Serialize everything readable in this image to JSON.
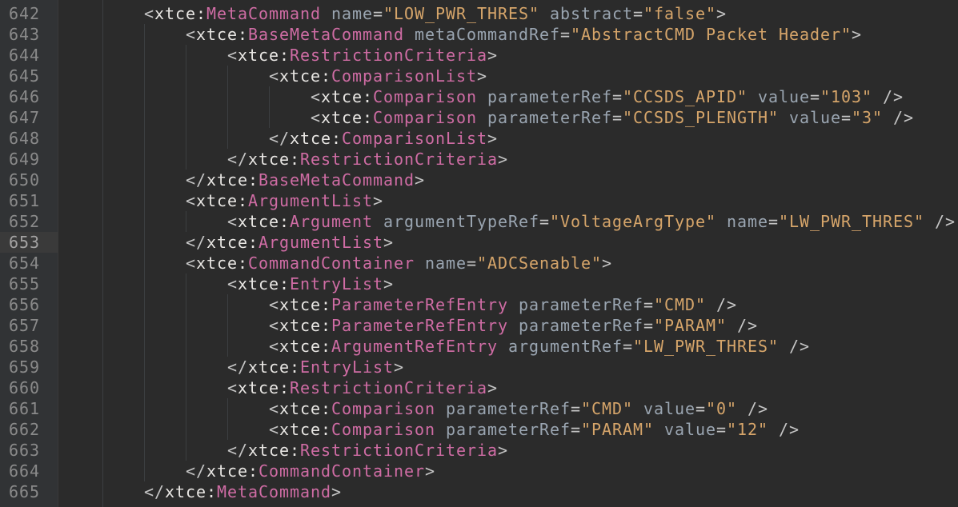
{
  "editor": {
    "current_line": "653",
    "lines": [
      {
        "num": "642",
        "indent": 4,
        "parts": [
          {
            "t": "punct",
            "v": "<"
          },
          {
            "t": "ns",
            "v": "xtce:"
          },
          {
            "t": "tag",
            "v": "MetaCommand"
          },
          {
            "t": "sp",
            "v": " "
          },
          {
            "t": "attr",
            "v": "name"
          },
          {
            "t": "eq",
            "v": "="
          },
          {
            "t": "val",
            "v": "\"LOW_PWR_THRES\""
          },
          {
            "t": "sp",
            "v": " "
          },
          {
            "t": "attr",
            "v": "abstract"
          },
          {
            "t": "eq",
            "v": "="
          },
          {
            "t": "val",
            "v": "\"false\""
          },
          {
            "t": "punct",
            "v": ">"
          }
        ]
      },
      {
        "num": "643",
        "indent": 8,
        "parts": [
          {
            "t": "punct",
            "v": "<"
          },
          {
            "t": "ns",
            "v": "xtce:"
          },
          {
            "t": "tag",
            "v": "BaseMetaCommand"
          },
          {
            "t": "sp",
            "v": " "
          },
          {
            "t": "attr",
            "v": "metaCommandRef"
          },
          {
            "t": "eq",
            "v": "="
          },
          {
            "t": "val",
            "v": "\"AbstractCMD Packet Header\""
          },
          {
            "t": "punct",
            "v": ">"
          }
        ]
      },
      {
        "num": "644",
        "indent": 12,
        "parts": [
          {
            "t": "punct",
            "v": "<"
          },
          {
            "t": "ns",
            "v": "xtce:"
          },
          {
            "t": "tag",
            "v": "RestrictionCriteria"
          },
          {
            "t": "punct",
            "v": ">"
          }
        ]
      },
      {
        "num": "645",
        "indent": 16,
        "parts": [
          {
            "t": "punct",
            "v": "<"
          },
          {
            "t": "ns",
            "v": "xtce:"
          },
          {
            "t": "tag",
            "v": "ComparisonList"
          },
          {
            "t": "punct",
            "v": ">"
          }
        ]
      },
      {
        "num": "646",
        "indent": 20,
        "parts": [
          {
            "t": "punct",
            "v": "<"
          },
          {
            "t": "ns",
            "v": "xtce:"
          },
          {
            "t": "tag",
            "v": "Comparison"
          },
          {
            "t": "sp",
            "v": " "
          },
          {
            "t": "attr",
            "v": "parameterRef"
          },
          {
            "t": "eq",
            "v": "="
          },
          {
            "t": "val",
            "v": "\"CCSDS_APID\""
          },
          {
            "t": "sp",
            "v": " "
          },
          {
            "t": "attr",
            "v": "value"
          },
          {
            "t": "eq",
            "v": "="
          },
          {
            "t": "val",
            "v": "\"103\""
          },
          {
            "t": "sp",
            "v": " "
          },
          {
            "t": "punct",
            "v": "/>"
          }
        ]
      },
      {
        "num": "647",
        "indent": 20,
        "parts": [
          {
            "t": "punct",
            "v": "<"
          },
          {
            "t": "ns",
            "v": "xtce:"
          },
          {
            "t": "tag",
            "v": "Comparison"
          },
          {
            "t": "sp",
            "v": " "
          },
          {
            "t": "attr",
            "v": "parameterRef"
          },
          {
            "t": "eq",
            "v": "="
          },
          {
            "t": "val",
            "v": "\"CCSDS_PLENGTH\""
          },
          {
            "t": "sp",
            "v": " "
          },
          {
            "t": "attr",
            "v": "value"
          },
          {
            "t": "eq",
            "v": "="
          },
          {
            "t": "val",
            "v": "\"3\""
          },
          {
            "t": "sp",
            "v": " "
          },
          {
            "t": "punct",
            "v": "/>"
          }
        ]
      },
      {
        "num": "648",
        "indent": 16,
        "parts": [
          {
            "t": "punct",
            "v": "</"
          },
          {
            "t": "ns",
            "v": "xtce:"
          },
          {
            "t": "tag",
            "v": "ComparisonList"
          },
          {
            "t": "punct",
            "v": ">"
          }
        ]
      },
      {
        "num": "649",
        "indent": 12,
        "parts": [
          {
            "t": "punct",
            "v": "</"
          },
          {
            "t": "ns",
            "v": "xtce:"
          },
          {
            "t": "tag",
            "v": "RestrictionCriteria"
          },
          {
            "t": "punct",
            "v": ">"
          }
        ]
      },
      {
        "num": "650",
        "indent": 8,
        "parts": [
          {
            "t": "punct",
            "v": "</"
          },
          {
            "t": "ns",
            "v": "xtce:"
          },
          {
            "t": "tag",
            "v": "BaseMetaCommand"
          },
          {
            "t": "punct",
            "v": ">"
          }
        ]
      },
      {
        "num": "651",
        "indent": 8,
        "parts": [
          {
            "t": "punct",
            "v": "<"
          },
          {
            "t": "ns",
            "v": "xtce:"
          },
          {
            "t": "tag",
            "v": "ArgumentList"
          },
          {
            "t": "punct",
            "v": ">"
          }
        ]
      },
      {
        "num": "652",
        "indent": 12,
        "parts": [
          {
            "t": "punct",
            "v": "<"
          },
          {
            "t": "ns",
            "v": "xtce:"
          },
          {
            "t": "tag",
            "v": "Argument"
          },
          {
            "t": "sp",
            "v": " "
          },
          {
            "t": "attr",
            "v": "argumentTypeRef"
          },
          {
            "t": "eq",
            "v": "="
          },
          {
            "t": "val",
            "v": "\"VoltageArgType\""
          },
          {
            "t": "sp",
            "v": " "
          },
          {
            "t": "attr",
            "v": "name"
          },
          {
            "t": "eq",
            "v": "="
          },
          {
            "t": "val",
            "v": "\"LW_PWR_THRES\""
          },
          {
            "t": "sp",
            "v": " "
          },
          {
            "t": "punct",
            "v": "/>"
          }
        ]
      },
      {
        "num": "653",
        "indent": 8,
        "parts": [
          {
            "t": "punct",
            "v": "</"
          },
          {
            "t": "ns",
            "v": "xtce:"
          },
          {
            "t": "tag",
            "v": "ArgumentList"
          },
          {
            "t": "punct",
            "v": ">"
          }
        ]
      },
      {
        "num": "654",
        "indent": 8,
        "parts": [
          {
            "t": "punct",
            "v": "<"
          },
          {
            "t": "ns",
            "v": "xtce:"
          },
          {
            "t": "tag",
            "v": "CommandContainer"
          },
          {
            "t": "sp",
            "v": " "
          },
          {
            "t": "attr",
            "v": "name"
          },
          {
            "t": "eq",
            "v": "="
          },
          {
            "t": "val",
            "v": "\"ADCSenable\""
          },
          {
            "t": "punct",
            "v": ">"
          }
        ]
      },
      {
        "num": "655",
        "indent": 12,
        "parts": [
          {
            "t": "punct",
            "v": "<"
          },
          {
            "t": "ns",
            "v": "xtce:"
          },
          {
            "t": "tag",
            "v": "EntryList"
          },
          {
            "t": "punct",
            "v": ">"
          }
        ]
      },
      {
        "num": "656",
        "indent": 16,
        "parts": [
          {
            "t": "punct",
            "v": "<"
          },
          {
            "t": "ns",
            "v": "xtce:"
          },
          {
            "t": "tag",
            "v": "ParameterRefEntry"
          },
          {
            "t": "sp",
            "v": " "
          },
          {
            "t": "attr",
            "v": "parameterRef"
          },
          {
            "t": "eq",
            "v": "="
          },
          {
            "t": "val",
            "v": "\"CMD\""
          },
          {
            "t": "sp",
            "v": " "
          },
          {
            "t": "punct",
            "v": "/>"
          }
        ]
      },
      {
        "num": "657",
        "indent": 16,
        "parts": [
          {
            "t": "punct",
            "v": "<"
          },
          {
            "t": "ns",
            "v": "xtce:"
          },
          {
            "t": "tag",
            "v": "ParameterRefEntry"
          },
          {
            "t": "sp",
            "v": " "
          },
          {
            "t": "attr",
            "v": "parameterRef"
          },
          {
            "t": "eq",
            "v": "="
          },
          {
            "t": "val",
            "v": "\"PARAM\""
          },
          {
            "t": "sp",
            "v": " "
          },
          {
            "t": "punct",
            "v": "/>"
          }
        ]
      },
      {
        "num": "658",
        "indent": 16,
        "parts": [
          {
            "t": "punct",
            "v": "<"
          },
          {
            "t": "ns",
            "v": "xtce:"
          },
          {
            "t": "tag",
            "v": "ArgumentRefEntry"
          },
          {
            "t": "sp",
            "v": " "
          },
          {
            "t": "attr",
            "v": "argumentRef"
          },
          {
            "t": "eq",
            "v": "="
          },
          {
            "t": "val",
            "v": "\"LW_PWR_THRES\""
          },
          {
            "t": "sp",
            "v": " "
          },
          {
            "t": "punct",
            "v": "/>"
          }
        ]
      },
      {
        "num": "659",
        "indent": 12,
        "parts": [
          {
            "t": "punct",
            "v": "</"
          },
          {
            "t": "ns",
            "v": "xtce:"
          },
          {
            "t": "tag",
            "v": "EntryList"
          },
          {
            "t": "punct",
            "v": ">"
          }
        ]
      },
      {
        "num": "660",
        "indent": 12,
        "parts": [
          {
            "t": "punct",
            "v": "<"
          },
          {
            "t": "ns",
            "v": "xtce:"
          },
          {
            "t": "tag",
            "v": "RestrictionCriteria"
          },
          {
            "t": "punct",
            "v": ">"
          }
        ]
      },
      {
        "num": "661",
        "indent": 16,
        "parts": [
          {
            "t": "punct",
            "v": "<"
          },
          {
            "t": "ns",
            "v": "xtce:"
          },
          {
            "t": "tag",
            "v": "Comparison"
          },
          {
            "t": "sp",
            "v": " "
          },
          {
            "t": "attr",
            "v": "parameterRef"
          },
          {
            "t": "eq",
            "v": "="
          },
          {
            "t": "val",
            "v": "\"CMD\""
          },
          {
            "t": "sp",
            "v": " "
          },
          {
            "t": "attr",
            "v": "value"
          },
          {
            "t": "eq",
            "v": "="
          },
          {
            "t": "val",
            "v": "\"0\""
          },
          {
            "t": "sp",
            "v": " "
          },
          {
            "t": "punct",
            "v": "/>"
          }
        ]
      },
      {
        "num": "662",
        "indent": 16,
        "parts": [
          {
            "t": "punct",
            "v": "<"
          },
          {
            "t": "ns",
            "v": "xtce:"
          },
          {
            "t": "tag",
            "v": "Comparison"
          },
          {
            "t": "sp",
            "v": " "
          },
          {
            "t": "attr",
            "v": "parameterRef"
          },
          {
            "t": "eq",
            "v": "="
          },
          {
            "t": "val",
            "v": "\"PARAM\""
          },
          {
            "t": "sp",
            "v": " "
          },
          {
            "t": "attr",
            "v": "value"
          },
          {
            "t": "eq",
            "v": "="
          },
          {
            "t": "val",
            "v": "\"12\""
          },
          {
            "t": "sp",
            "v": " "
          },
          {
            "t": "punct",
            "v": "/>"
          }
        ]
      },
      {
        "num": "663",
        "indent": 12,
        "parts": [
          {
            "t": "punct",
            "v": "</"
          },
          {
            "t": "ns",
            "v": "xtce:"
          },
          {
            "t": "tag",
            "v": "RestrictionCriteria"
          },
          {
            "t": "punct",
            "v": ">"
          }
        ]
      },
      {
        "num": "664",
        "indent": 8,
        "parts": [
          {
            "t": "punct",
            "v": "</"
          },
          {
            "t": "ns",
            "v": "xtce:"
          },
          {
            "t": "tag",
            "v": "CommandContainer"
          },
          {
            "t": "punct",
            "v": ">"
          }
        ]
      },
      {
        "num": "665",
        "indent": 4,
        "parts": [
          {
            "t": "punct",
            "v": "</"
          },
          {
            "t": "ns",
            "v": "xtce:"
          },
          {
            "t": "tag",
            "v": "MetaCommand"
          },
          {
            "t": "punct",
            "v": ">"
          }
        ]
      }
    ]
  }
}
